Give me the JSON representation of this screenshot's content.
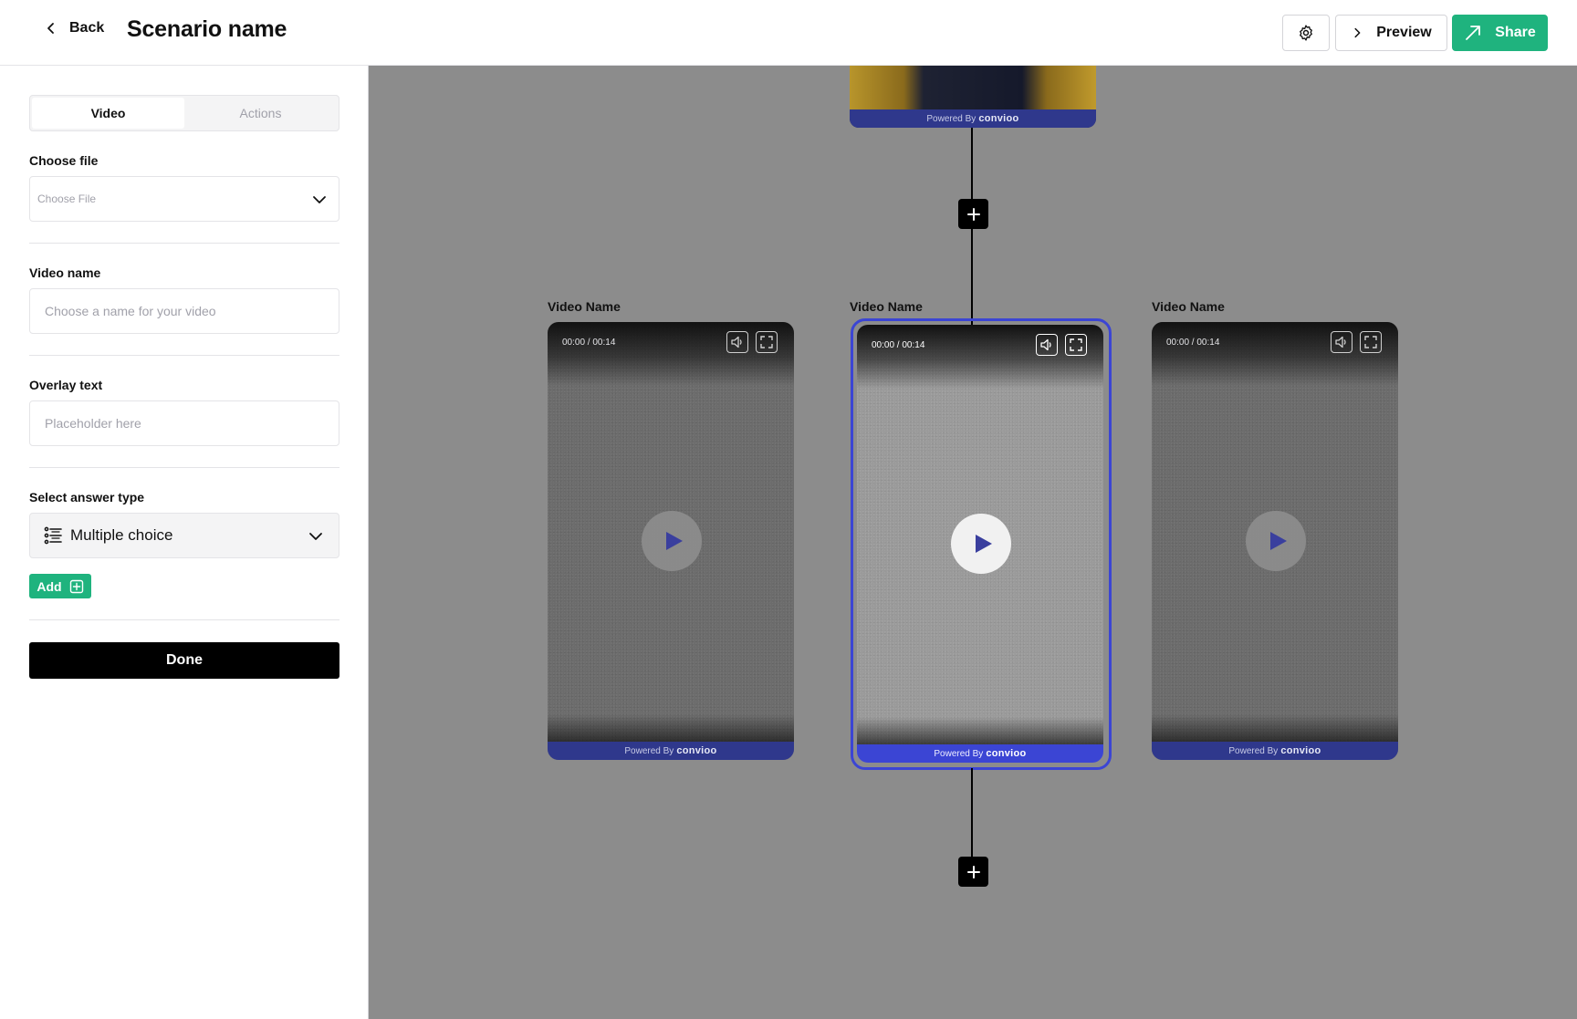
{
  "header": {
    "back_label": "Back",
    "title": "Scenario name",
    "preview_label": "Preview",
    "share_label": "Share"
  },
  "sidebar": {
    "tabs": [
      {
        "label": "Video",
        "active": true
      },
      {
        "label": "Actions",
        "active": false
      }
    ],
    "choose_file": {
      "label": "Choose file",
      "placeholder": "Choose File"
    },
    "video_name": {
      "label": "Video name",
      "placeholder": "Choose a name for your video"
    },
    "overlay_text": {
      "label": "Overlay text",
      "placeholder": "Placeholder here"
    },
    "answer_type": {
      "label": "Select answer type",
      "value": "Multiple choice"
    },
    "add_label": "Add",
    "done_label": "Done"
  },
  "canvas": {
    "top_card": {
      "powered_prefix": "Powered By",
      "brand": "convioo"
    },
    "videos": [
      {
        "name": "Video Name",
        "time": "00:00 / 00:14",
        "powered_prefix": "Powered By",
        "brand": "convioo",
        "selected": false
      },
      {
        "name": "Video Name",
        "time": "00:00 / 00:14",
        "powered_prefix": "Powered By",
        "brand": "convioo",
        "selected": true
      },
      {
        "name": "Video Name",
        "time": "00:00 / 00:14",
        "powered_prefix": "Powered By",
        "brand": "convioo",
        "selected": false
      }
    ]
  },
  "colors": {
    "accent_green": "#1fb37e",
    "selection_blue": "#3b45d4",
    "canvas_bg": "#8c8c8c",
    "powered_bar": "#2f388c",
    "play_icon": "#3a3f9e"
  },
  "icons": {
    "back": "chevron-left-icon",
    "settings": "gear-icon",
    "preview": "chevron-right-icon",
    "share": "arrow-up-right-icon",
    "dropdown": "chevron-down-icon",
    "answer_type": "list-icon",
    "add": "plus-square-icon",
    "node": "plus-icon",
    "volume": "speaker-icon",
    "fullscreen": "fullscreen-icon",
    "play": "play-icon"
  }
}
